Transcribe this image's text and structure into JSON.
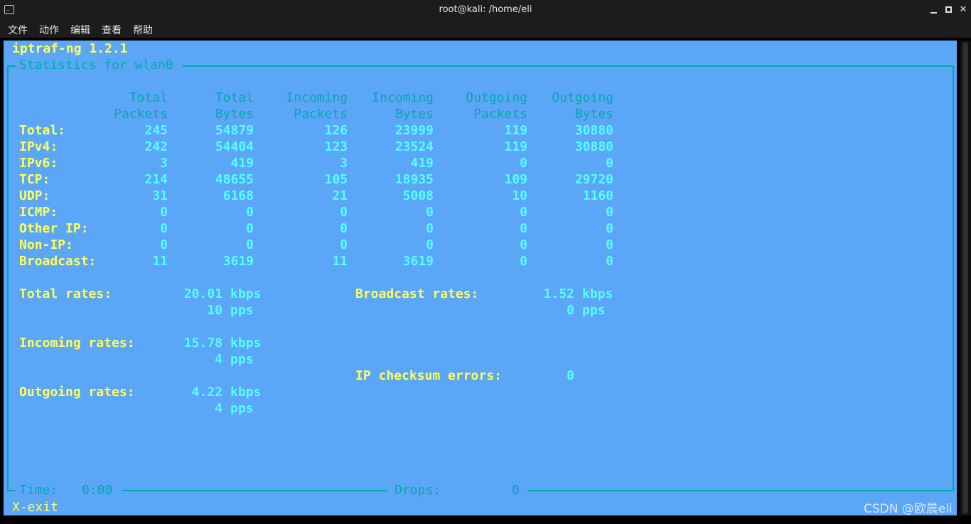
{
  "window": {
    "title": "root@kali: /home/eli",
    "icon": "terminal-icon"
  },
  "menu": [
    "文件",
    "动作",
    "编辑",
    "查看",
    "帮助"
  ],
  "app": {
    "name": "iptraf-ng 1.2.1",
    "box_title": "Statistics for wlan0"
  },
  "table": {
    "headers": [
      [
        "Total",
        "Packets"
      ],
      [
        "Total",
        "Bytes"
      ],
      [
        "Incoming",
        "Packets"
      ],
      [
        "Incoming",
        "Bytes"
      ],
      [
        "Outgoing",
        "Packets"
      ],
      [
        "Outgoing",
        "Bytes"
      ]
    ],
    "rows": [
      {
        "label": "Total:",
        "values": [
          "245",
          "54879",
          "126",
          "23999",
          "119",
          "30880"
        ]
      },
      {
        "label": "IPv4:",
        "values": [
          "242",
          "54404",
          "123",
          "23524",
          "119",
          "30880"
        ]
      },
      {
        "label": "IPv6:",
        "values": [
          "3",
          "419",
          "3",
          "419",
          "0",
          "0"
        ]
      },
      {
        "label": "TCP:",
        "values": [
          "214",
          "48655",
          "105",
          "18935",
          "109",
          "29720"
        ]
      },
      {
        "label": "UDP:",
        "values": [
          "31",
          "6168",
          "21",
          "5008",
          "10",
          "1160"
        ]
      },
      {
        "label": "ICMP:",
        "values": [
          "0",
          "0",
          "0",
          "0",
          "0",
          "0"
        ]
      },
      {
        "label": "Other IP:",
        "values": [
          "0",
          "0",
          "0",
          "0",
          "0",
          "0"
        ]
      },
      {
        "label": "Non-IP:",
        "values": [
          "0",
          "0",
          "0",
          "0",
          "0",
          "0"
        ]
      },
      {
        "label": "Broadcast:",
        "values": [
          "11",
          "3619",
          "11",
          "3619",
          "0",
          "0"
        ]
      }
    ]
  },
  "rates": {
    "total_label": "Total rates:",
    "total_kbps": "20.01",
    "total_pps": "10",
    "incoming_label": "Incoming rates:",
    "incoming_kbps": "15.78",
    "incoming_pps": "4",
    "outgoing_label": "Outgoing rates:",
    "outgoing_kbps": "4.22",
    "outgoing_pps": "4",
    "broadcast_label": "Broadcast rates:",
    "broadcast_kbps": "1.52",
    "broadcast_pps": "0",
    "kbps_unit": "kbps",
    "pps_unit": "pps",
    "checksum_label": "IP checksum errors:",
    "checksum_value": "0"
  },
  "footer": {
    "time_label": "Time:",
    "time_value": "0:00",
    "drops_label": "Drops:",
    "drops_value": "0",
    "exit_hint": "X-exit"
  },
  "watermark": "CSDN @欧晨eli",
  "colors": {
    "terminal_bg": "#5ca6f8",
    "label_yellow": "#ffff55",
    "value_cyan": "#55ffff",
    "frame_cyan": "#00aaaa"
  }
}
